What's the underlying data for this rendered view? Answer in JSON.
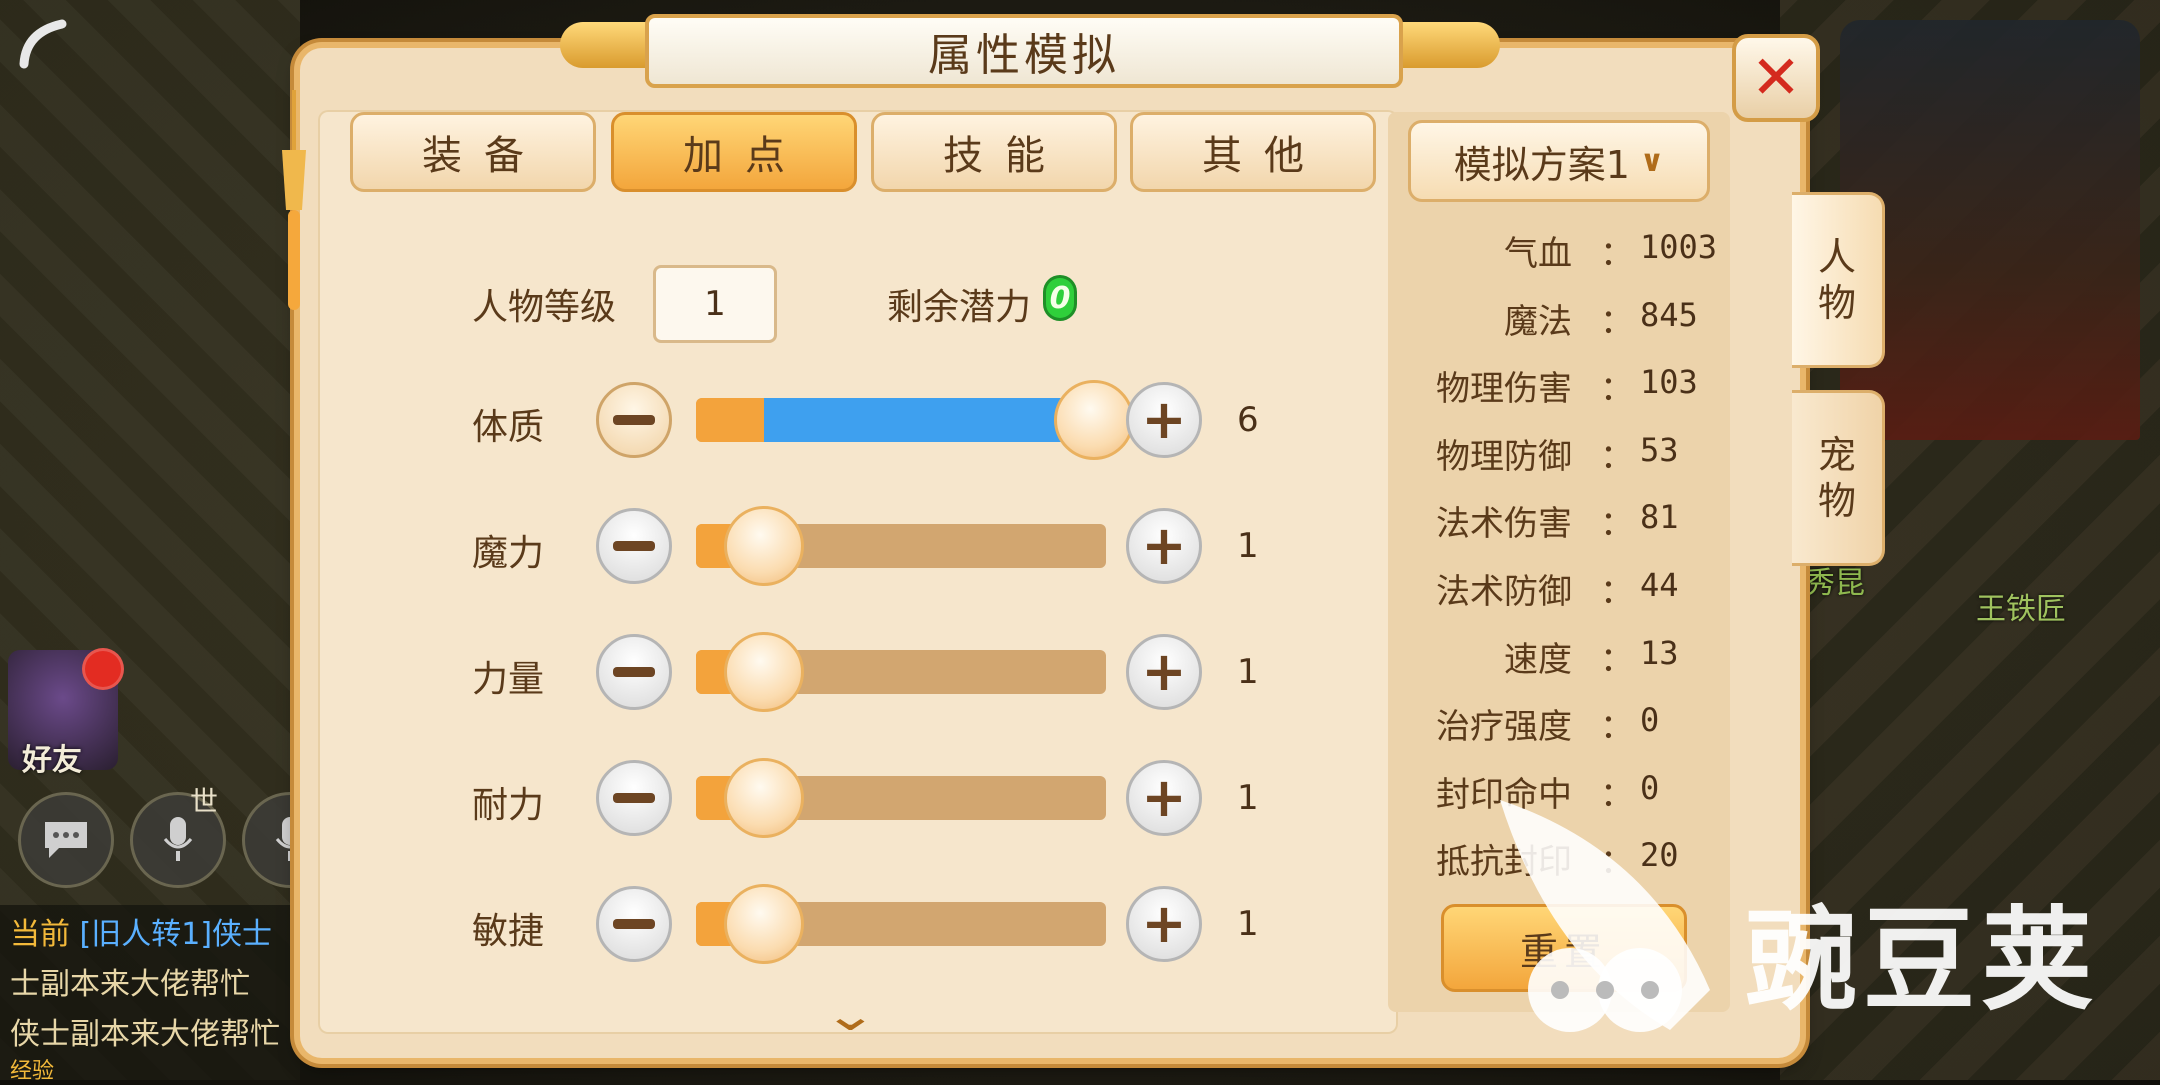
{
  "dialog": {
    "title": "属性模拟",
    "tabs": [
      {
        "label": "装备",
        "active": false
      },
      {
        "label": "加点",
        "active": true
      },
      {
        "label": "技能",
        "active": false
      },
      {
        "label": "其他",
        "active": false
      }
    ],
    "level_label": "人物等级",
    "level_value": "1",
    "potential_label": "剩余潜力",
    "potential_value": "0",
    "stats": [
      {
        "label": "体质",
        "value": "6",
        "fill": 1.0
      },
      {
        "label": "魔力",
        "value": "1",
        "fill": 0.0
      },
      {
        "label": "力量",
        "value": "1",
        "fill": 0.0
      },
      {
        "label": "耐力",
        "value": "1",
        "fill": 0.0
      },
      {
        "label": "敏捷",
        "value": "1",
        "fill": 0.0
      }
    ],
    "plan_dropdown": "模拟方案1",
    "attributes": [
      {
        "name": "气血",
        "value": "1003"
      },
      {
        "name": "魔法",
        "value": "845"
      },
      {
        "name": "物理伤害",
        "value": "103"
      },
      {
        "name": "物理防御",
        "value": "53"
      },
      {
        "name": "法术伤害",
        "value": "81"
      },
      {
        "name": "法术防御",
        "value": "44"
      },
      {
        "name": "速度",
        "value": "13"
      },
      {
        "name": "治疗强度",
        "value": "0"
      },
      {
        "name": "封印命中",
        "value": "0"
      },
      {
        "name": "抵抗封印",
        "value": "20"
      }
    ],
    "colon": "：",
    "reset_label": "重置",
    "side_tabs": [
      {
        "label": "人物",
        "active": true
      },
      {
        "label": "宠物",
        "active": false
      }
    ]
  },
  "background": {
    "friend_label": "好友",
    "world_tag": "世",
    "npc_names": [
      "秀昆",
      "王铁匠"
    ],
    "chat": [
      {
        "prefix": "当前",
        "channel": "[旧人转1]侠士",
        "text": ""
      },
      {
        "prefix": "",
        "channel": "",
        "text": "士副本来大佬帮忙"
      },
      {
        "prefix": "",
        "channel": "",
        "text": "侠士副本来大佬帮忙"
      }
    ],
    "exp_label": "经验"
  },
  "watermark": "豌豆荚",
  "colors": {
    "accent_orange": "#f3a63c",
    "fill_blue": "#3ea0ef",
    "close_red": "#d42a1e",
    "potential_green": "#2fcf3b"
  }
}
